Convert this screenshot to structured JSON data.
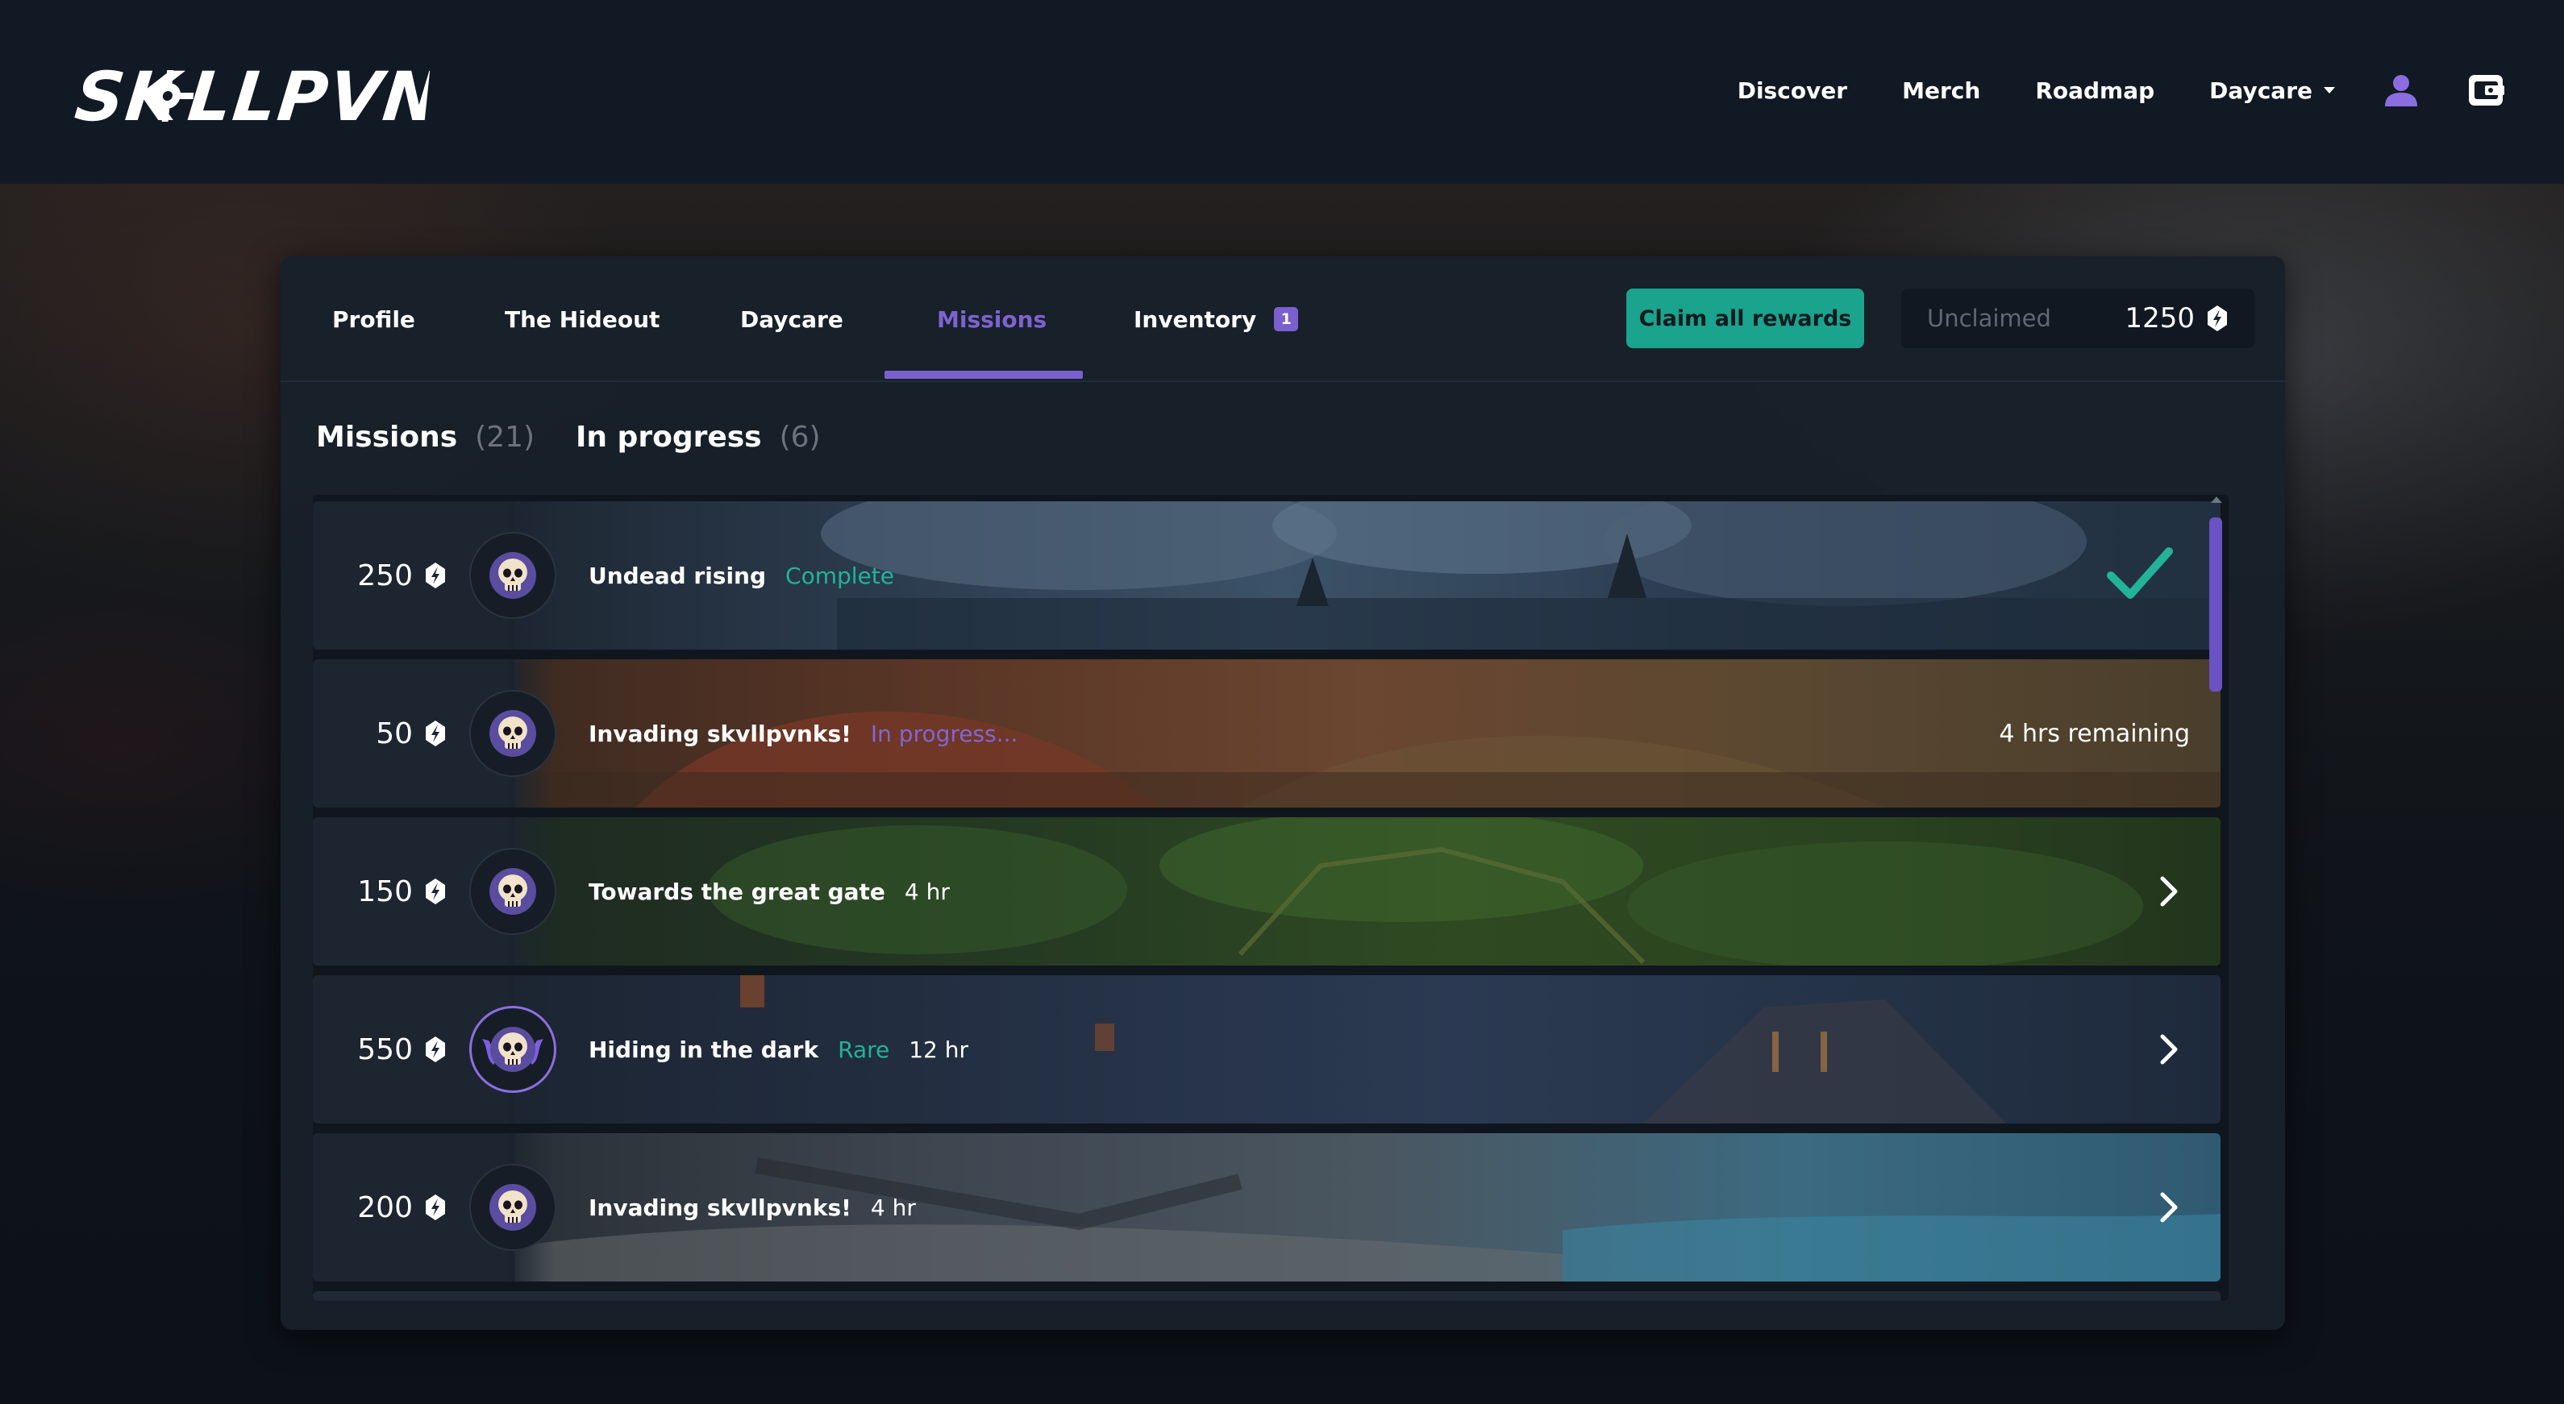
{
  "brand": {
    "logo_text": "SK☸LLPVNKZ"
  },
  "nav": {
    "links": [
      "Discover",
      "Merch",
      "Roadmap",
      "Daycare"
    ],
    "user_icon": "user-icon",
    "wallet_icon": "wallet-icon"
  },
  "tabs": [
    {
      "label": "Profile"
    },
    {
      "label": "The Hideout"
    },
    {
      "label": "Daycare"
    },
    {
      "label": "Missions",
      "active": true
    },
    {
      "label": "Inventory",
      "badge": "1"
    }
  ],
  "actions": {
    "claim_label": "Claim all rewards",
    "unclaimed_label": "Unclaimed",
    "unclaimed_value": "1250"
  },
  "subheader": {
    "missions_label": "Missions",
    "missions_count": "(21)",
    "progress_label": "In progress",
    "progress_count": "(6)"
  },
  "missions": [
    {
      "reward": "250",
      "name": "Undead rising",
      "status": "Complete",
      "state": "complete"
    },
    {
      "reward": "50",
      "name": "Invading skvllpvnks!",
      "status": "In progress...",
      "remaining": "4 hrs remaining",
      "state": "in-progress"
    },
    {
      "reward": "150",
      "name": "Towards the great gate",
      "duration": "4 hr",
      "state": "available"
    },
    {
      "reward": "550",
      "name": "Hiding in the dark",
      "tag": "Rare",
      "duration": "12 hr",
      "state": "available",
      "rare": true
    },
    {
      "reward": "200",
      "name": "Invading skvllpvnks!",
      "duration": "4 hr",
      "state": "available"
    }
  ],
  "colors": {
    "accent_purple": "#7a5fcf",
    "accent_teal": "#1aa38d",
    "background": "#0d1219",
    "panel": "#182029"
  }
}
